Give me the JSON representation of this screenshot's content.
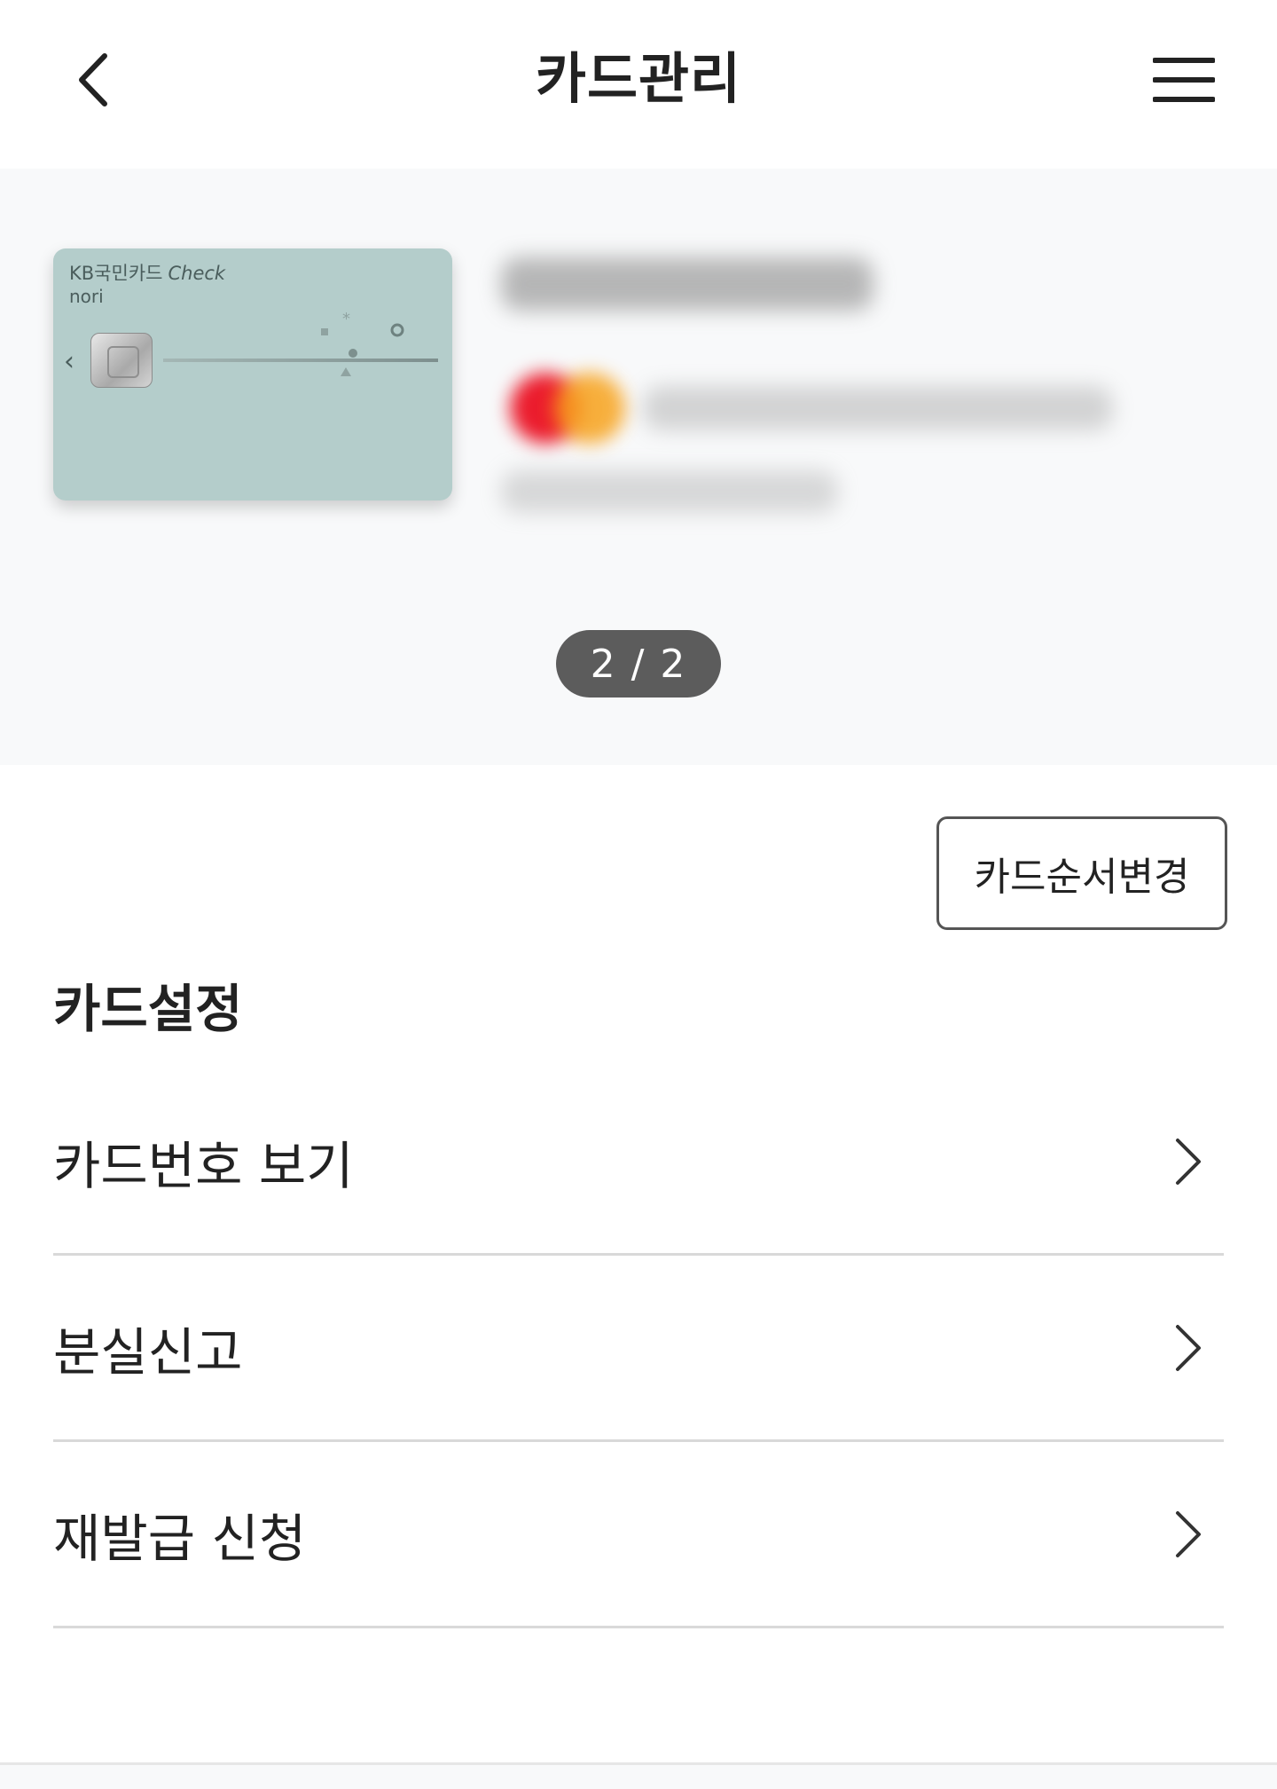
{
  "header": {
    "title": "카드관리",
    "back_icon": "chevron-left-icon",
    "menu_icon": "hamburger-menu-icon"
  },
  "card": {
    "brand": "KB국민카드",
    "brand_suffix": "Check",
    "name": "nori",
    "color": "#b4cdcb"
  },
  "pager": {
    "text": "2 / 2"
  },
  "actions": {
    "order_change_label": "카드순서변경"
  },
  "settings": {
    "title": "카드설정",
    "items": [
      {
        "label": "카드번호 보기",
        "icon": "chevron-right-icon"
      },
      {
        "label": "분실신고",
        "icon": "chevron-right-icon"
      },
      {
        "label": "재발급 신청",
        "icon": "chevron-right-icon"
      }
    ]
  }
}
